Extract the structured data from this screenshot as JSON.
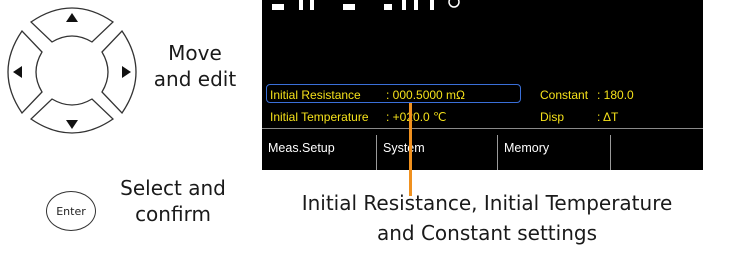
{
  "controls": {
    "arrow_keys_label_line1": "Move",
    "arrow_keys_label_line2": "and edit",
    "enter_key_text": "Enter",
    "enter_label_line1": "Select and",
    "enter_label_line2": "confirm"
  },
  "screen": {
    "initial_resistance_label": "Initial Resistance",
    "initial_resistance_value": ": 000.5000 mΩ",
    "initial_temperature_label": "Initial Temperature",
    "initial_temperature_value": ": +020.0 ℃",
    "constant_label": "Constant",
    "constant_value": ": 180.0",
    "disp_label": "Disp",
    "disp_value": ": ΔT",
    "softkeys": [
      "Meas.Setup",
      "System",
      "Memory",
      "",
      ""
    ]
  },
  "caption": {
    "line1": "Initial Resistance, Initial Temperature",
    "line2": "and Constant settings"
  },
  "colors": {
    "screen_bg": "#000000",
    "screen_text": "#f5e11a",
    "selection_border": "#3a6fd8",
    "callout": "#f0911f"
  }
}
